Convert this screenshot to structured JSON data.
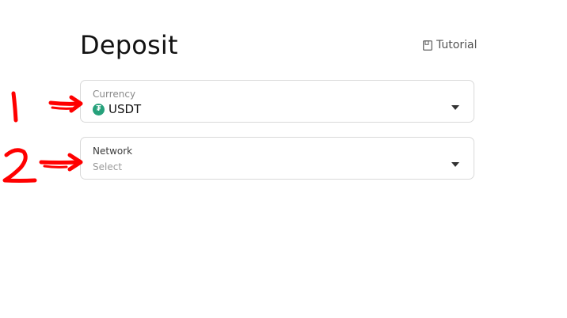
{
  "header": {
    "title": "Deposit",
    "tutorial_label": "Tutorial",
    "tutorial_icon": "book-icon"
  },
  "currency_field": {
    "label": "Currency",
    "value": "USDT",
    "coin_icon": "tether-icon",
    "coin_symbol": "₮",
    "coin_color": "#26a17b"
  },
  "network_field": {
    "label": "Network",
    "placeholder": "Select"
  },
  "annotations": {
    "color": "#ff0000",
    "marks": [
      "1",
      "2"
    ]
  }
}
